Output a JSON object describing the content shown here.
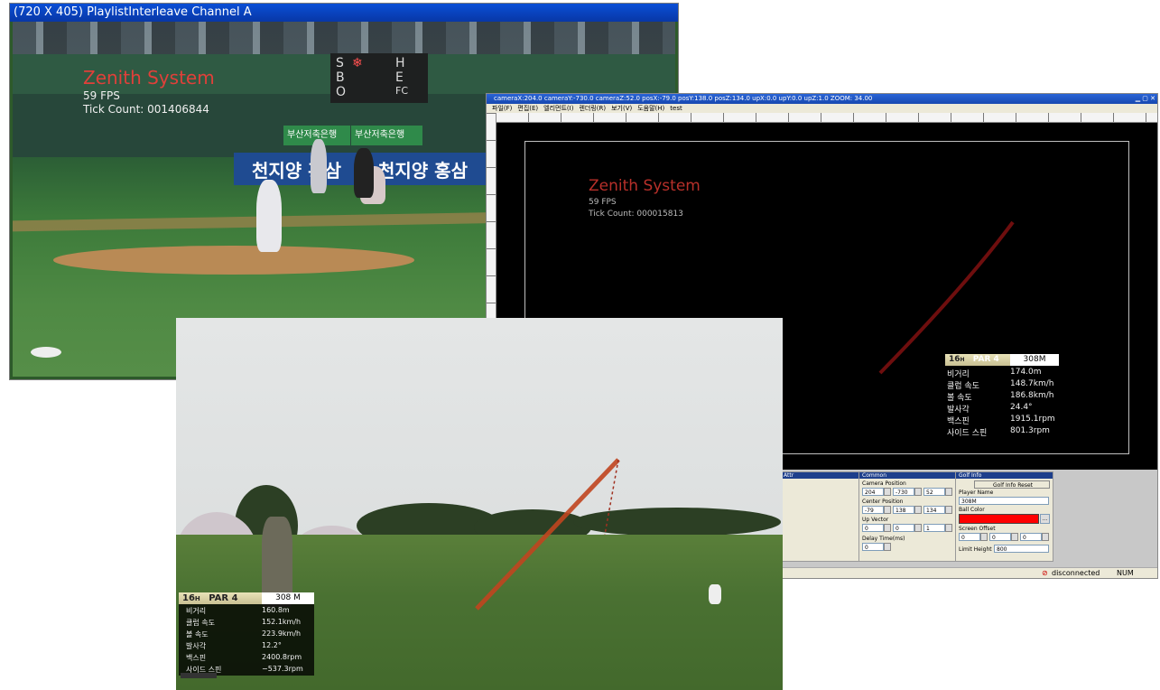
{
  "winA": {
    "title": "(720 X 405)  PlaylistInterleave Channel A",
    "overlay": {
      "system": "Zenith System",
      "fps": "59 FPS",
      "tick": "Tick Count: 001406844"
    },
    "scoreboard": {
      "s": "S",
      "b": "B",
      "o": "O",
      "h": "H",
      "e": "E",
      "fc": "FC"
    },
    "banners": {
      "left": "천지양 홍삼",
      "right": "천지양 홍삼",
      "green1": "부산저축은행",
      "green2": "부산저축은행"
    }
  },
  "winB": {
    "title": "cameraX:204.0  cameraY:-730.0 cameraZ:52.0  posX:-79.0  posY:138.0 posZ:134.0 upX:0.0  upY:0.0 upZ:1.0 ZOOM: 34.00",
    "menu": [
      "파일(F)",
      "편집(E)",
      "엘리먼트(I)",
      "렌더링(R)",
      "보기(V)",
      "도움말(H)",
      "test"
    ],
    "overlay": {
      "system": "Zenith System",
      "fps": "59 FPS",
      "tick": "Tick Count: 000015813"
    },
    "stats": {
      "hole": "16",
      "hole_suffix": "H",
      "par": "PAR 4",
      "distance": "308M",
      "rows": [
        {
          "label": "비거리",
          "value": "174.0m"
        },
        {
          "label": "클럽 속도",
          "value": "148.7km/h"
        },
        {
          "label": "볼 속도",
          "value": "186.8km/h"
        },
        {
          "label": "발사각",
          "value": "24.4°"
        },
        {
          "label": "백스핀",
          "value": "1915.1rpm"
        },
        {
          "label": "사이드 스핀",
          "value": "801.3rpm"
        }
      ]
    },
    "panels": {
      "attr": {
        "header": "Attr"
      },
      "common": {
        "header": "Common",
        "camera_position_label": "Camera Position",
        "camera_position": [
          "204",
          "-730",
          "52"
        ],
        "center_position_label": "Center Position",
        "center_position": [
          "-79",
          "138",
          "134"
        ],
        "up_vector_label": "Up Vector",
        "up_vector": [
          "0",
          "0",
          "1"
        ],
        "delay_label": "Delay Time(ms)",
        "delay": "0"
      },
      "golf": {
        "header": "Golf Info",
        "reset_button": "Golf Info Reset",
        "player_name_label": "Player Name",
        "player_name": "308M",
        "ball_color_label": "Ball Color",
        "ball_color": "#ff0000",
        "browse_button": "...",
        "screen_offset_label": "Screen Offset",
        "screen_offset": [
          "0",
          "0",
          "0"
        ],
        "limit_height_label": "Limit Height",
        "limit_height": "800"
      }
    },
    "status": {
      "connection": "disconnected",
      "num": "NUM"
    }
  },
  "winC": {
    "stats": {
      "hole": "16",
      "hole_suffix": "H",
      "par": "PAR 4",
      "distance": "308 M",
      "rows": [
        {
          "label": "비거리",
          "value": "160.8m"
        },
        {
          "label": "클럽 속도",
          "value": "152.1km/h"
        },
        {
          "label": "볼 속도",
          "value": "223.9km/h"
        },
        {
          "label": "발사각",
          "value": "12.2°"
        },
        {
          "label": "백스핀",
          "value": "2400.8rpm"
        },
        {
          "label": "사이드 스핀",
          "value": "−537.3rpm"
        }
      ]
    }
  },
  "colors": {
    "trace": "#c0451f",
    "trace_dark": "#7a1010",
    "title_blue": "#0a4fd6",
    "overlay_red": "#e0403a"
  }
}
